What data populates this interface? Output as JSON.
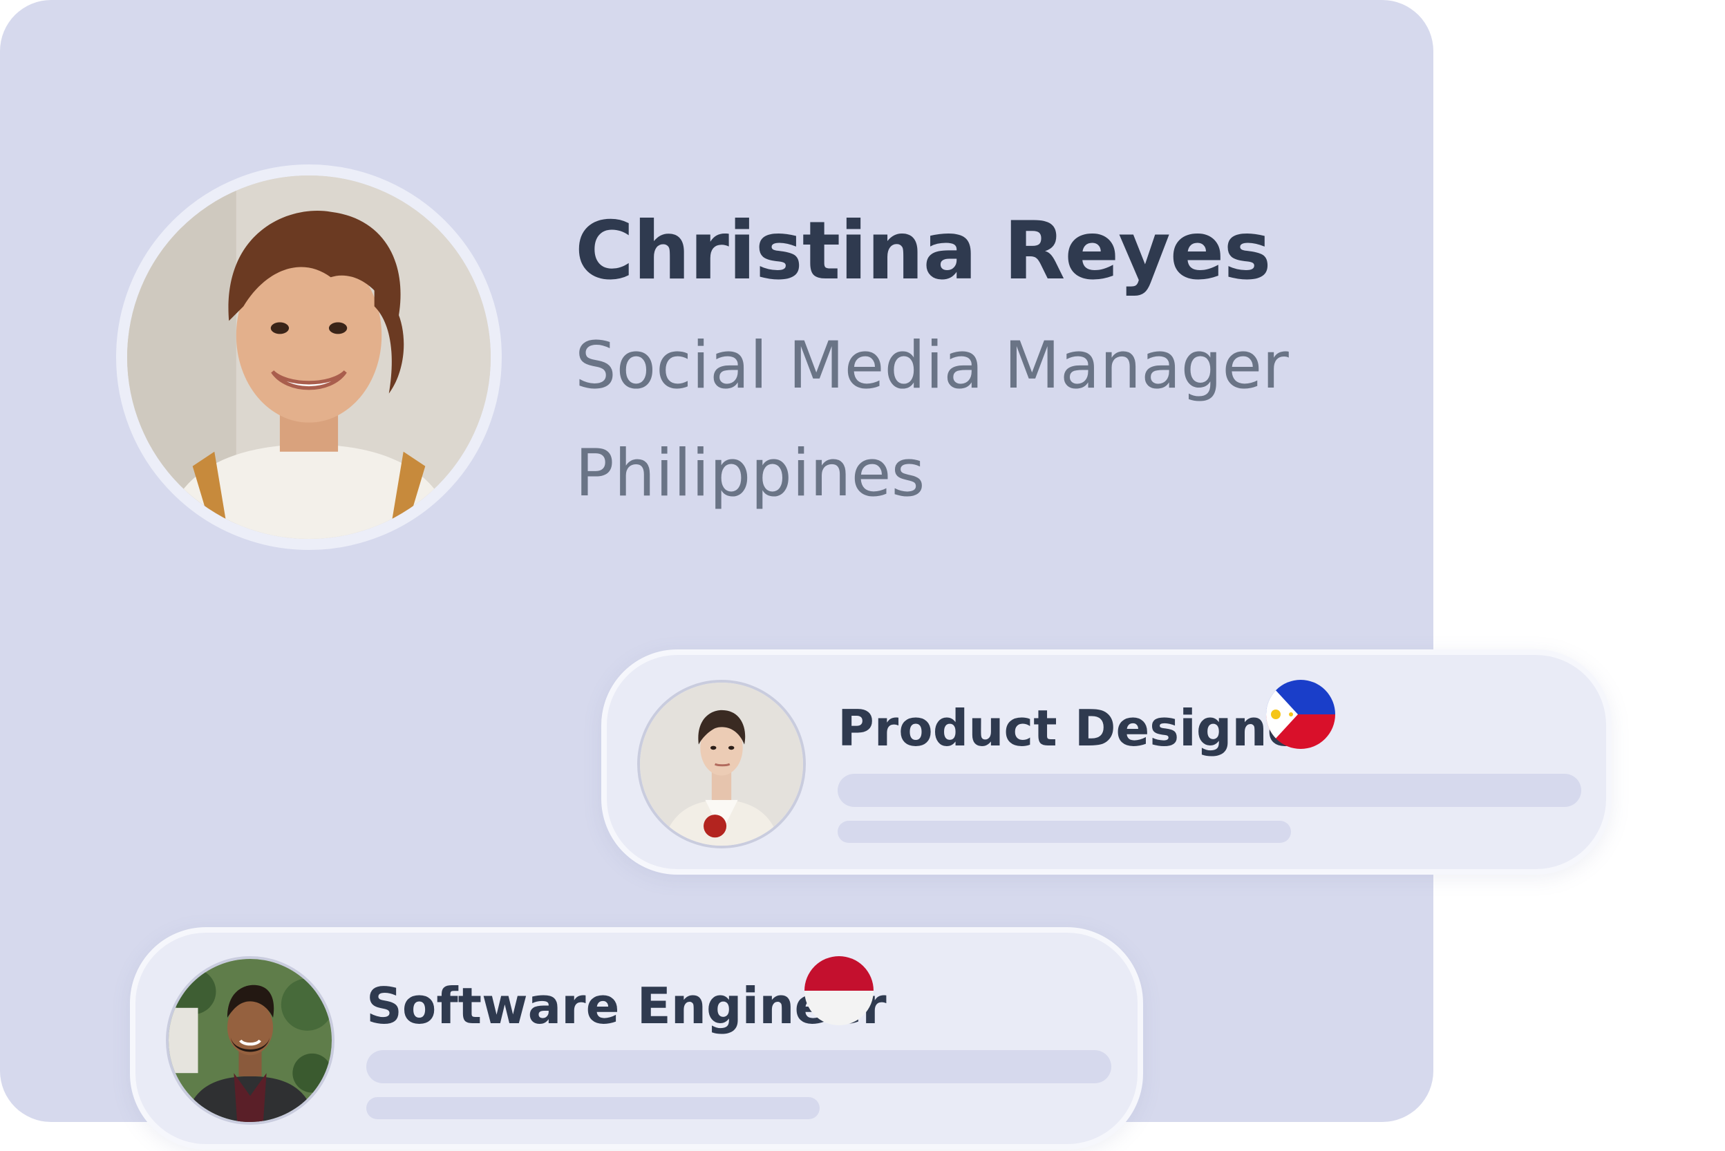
{
  "profile": {
    "name": "Christina Reyes",
    "role": "Social Media Manager",
    "location": "Philippines",
    "avatar_icon": "avatar-photo"
  },
  "cards": [
    {
      "title": "Product Designer",
      "flag": "philippines-flag-icon"
    },
    {
      "title": "Software Engineer",
      "flag": "indonesia-flag-icon"
    }
  ],
  "colors": {
    "card_background": "#d6d9ed",
    "mini_card_background": "#e9ebf6",
    "text_primary": "#2f3a4f",
    "text_secondary": "#6a7486"
  }
}
